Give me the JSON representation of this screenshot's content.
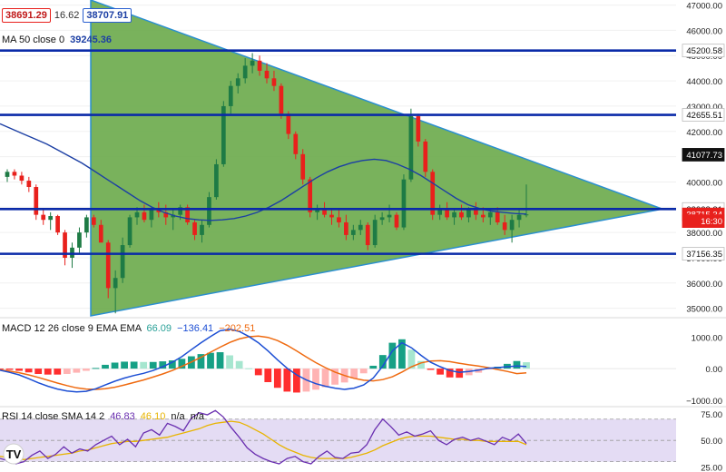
{
  "header": {
    "bid": "38691.29",
    "spread": "16.62",
    "ask": "38707.91",
    "ma_label": "MA 50 close 0",
    "ma_value": "39245.36"
  },
  "colors": {
    "up": "#1e7b45",
    "down": "#e8201c",
    "ma": "#1c3fa4",
    "line": "#0a2aa8",
    "triangle": "#6aaa4a",
    "triangle_edge": "#2a8fd0",
    "macd": "#1d4fd4",
    "signal": "#ef6a10",
    "rsi": "#6a2fb0",
    "rsi_sma": "#e8b400",
    "rsi_band": "#e4dcf4"
  },
  "chart_data": [
    {
      "type": "candlestick",
      "title": "",
      "y_ticks": [
        35000,
        36000,
        37000,
        38000,
        39000,
        40000,
        41000,
        42000,
        43000,
        44000,
        45000,
        46000,
        47000
      ],
      "ylim": [
        34700,
        47200
      ],
      "candles": [
        [
          40200,
          40500,
          40000,
          40400
        ],
        [
          40400,
          40500,
          40100,
          40250
        ],
        [
          40250,
          40400,
          39900,
          40050
        ],
        [
          40050,
          40200,
          39600,
          39800
        ],
        [
          39800,
          39900,
          38500,
          38700
        ],
        [
          38700,
          38900,
          38300,
          38500
        ],
        [
          38500,
          38800,
          38100,
          38650
        ],
        [
          38650,
          38700,
          37900,
          38000
        ],
        [
          38000,
          38100,
          36700,
          37000
        ],
        [
          37000,
          37600,
          36600,
          37400
        ],
        [
          37400,
          38200,
          37200,
          38000
        ],
        [
          38000,
          38700,
          37800,
          38600
        ],
        [
          38600,
          38700,
          38200,
          38300
        ],
        [
          38300,
          38500,
          37700,
          37600
        ],
        [
          37600,
          37700,
          35400,
          35800
        ],
        [
          35800,
          36500,
          34800,
          36200
        ],
        [
          36200,
          37800,
          36000,
          37500
        ],
        [
          37500,
          38700,
          37400,
          38600
        ],
        [
          38600,
          39000,
          38300,
          38800
        ],
        [
          38800,
          39100,
          38400,
          38500
        ],
        [
          38500,
          39000,
          38200,
          38900
        ],
        [
          38900,
          39200,
          38600,
          38800
        ],
        [
          38800,
          39100,
          38300,
          38600
        ],
        [
          38600,
          38900,
          38100,
          38700
        ],
        [
          38700,
          39100,
          38500,
          39000
        ],
        [
          39000,
          39100,
          38300,
          38400
        ],
        [
          38400,
          38500,
          37700,
          37900
        ],
        [
          37900,
          38500,
          37600,
          38300
        ],
        [
          38300,
          39600,
          38200,
          39400
        ],
        [
          39400,
          40900,
          39300,
          40700
        ],
        [
          40700,
          43200,
          40600,
          43000
        ],
        [
          43000,
          44000,
          42700,
          43800
        ],
        [
          43800,
          44300,
          43500,
          44100
        ],
        [
          44100,
          44900,
          43900,
          44600
        ],
        [
          44600,
          45100,
          44300,
          44800
        ],
        [
          44800,
          45000,
          44200,
          44400
        ],
        [
          44400,
          44700,
          43900,
          44100
        ],
        [
          44100,
          44400,
          43600,
          43800
        ],
        [
          43800,
          43900,
          42500,
          42700
        ],
        [
          42700,
          42800,
          41700,
          41900
        ],
        [
          41900,
          42000,
          40900,
          41100
        ],
        [
          41100,
          41300,
          39900,
          40100
        ],
        [
          40100,
          40200,
          38600,
          38800
        ],
        [
          38800,
          39100,
          38500,
          38900
        ],
        [
          38900,
          39200,
          38600,
          38700
        ],
        [
          38700,
          38900,
          38300,
          38600
        ],
        [
          38600,
          38900,
          38200,
          38400
        ],
        [
          38400,
          38700,
          37700,
          37900
        ],
        [
          37900,
          38300,
          37700,
          38100
        ],
        [
          38100,
          38500,
          37900,
          38300
        ],
        [
          38300,
          38400,
          37300,
          37500
        ],
        [
          37500,
          38700,
          37400,
          38500
        ],
        [
          38500,
          38800,
          38300,
          38600
        ],
        [
          38600,
          39100,
          38400,
          38700
        ],
        [
          38700,
          38800,
          38100,
          38200
        ],
        [
          38200,
          40300,
          38100,
          40100
        ],
        [
          40100,
          42900,
          40000,
          42600
        ],
        [
          42600,
          42700,
          41400,
          41600
        ],
        [
          41600,
          41700,
          40200,
          40400
        ],
        [
          40400,
          40500,
          38500,
          38700
        ],
        [
          38700,
          39100,
          38500,
          38900
        ],
        [
          38900,
          39200,
          38500,
          38600
        ],
        [
          38600,
          38900,
          38300,
          38800
        ],
        [
          38800,
          39100,
          38500,
          38600
        ],
        [
          38600,
          39000,
          38400,
          38900
        ],
        [
          38900,
          39200,
          38500,
          38700
        ],
        [
          38700,
          39000,
          38400,
          38600
        ],
        [
          38600,
          38900,
          38300,
          38800
        ],
        [
          38800,
          39000,
          38300,
          38400
        ],
        [
          38400,
          38700,
          37900,
          38100
        ],
        [
          38100,
          38700,
          37600,
          38500
        ],
        [
          38500,
          38900,
          38200,
          38700
        ],
        [
          38700,
          39900,
          38600,
          38715
        ]
      ],
      "ma50": [
        42300,
        42100,
        41900,
        41700,
        41500,
        41250,
        41000,
        40750,
        40450,
        40150,
        39850,
        39550,
        39250,
        39000,
        38800,
        38650,
        38550,
        38500,
        38480,
        38500,
        38550,
        38650,
        38800,
        39000,
        39250,
        39550,
        39850,
        40150,
        40400,
        40600,
        40750,
        40850,
        40900,
        40850,
        40700,
        40500,
        40250,
        39950,
        39650,
        39350,
        39100,
        38950,
        38850,
        38800,
        38750,
        38730
      ],
      "h_lines": [
        45200.58,
        42655.51,
        38928.81,
        37156.35
      ],
      "price_labels": [
        {
          "text": "45200.58",
          "v": 45200.58
        },
        {
          "text": "42655.51",
          "v": 42655.51
        },
        {
          "text": "41077.73",
          "v": 41077.73
        },
        {
          "text": "38928.81",
          "v": 38928.81
        },
        {
          "text": "38715.34",
          "v": 38715.34
        },
        {
          "text": "16:30",
          "v": 38450
        },
        {
          "text": "37156.35",
          "v": 37156.35
        }
      ]
    },
    {
      "type": "line",
      "title": "MACD 12 26 close 9 EMA EMA",
      "values_text": [
        "66.09",
        "−136.41",
        "−202.51"
      ],
      "y_ticks": [
        "1000.00",
        "0.00",
        "−1000.00"
      ],
      "tick_values": [
        1000,
        0,
        -1000
      ],
      "ylim": [
        -1150,
        1500
      ],
      "macd": [
        -50,
        -120,
        -200,
        -320,
        -450,
        -560,
        -650,
        -710,
        -740,
        -720,
        -640,
        -520,
        -400,
        -300,
        -220,
        -150,
        -60,
        60,
        200,
        380,
        600,
        820,
        1020,
        1200,
        1250,
        1180,
        1020,
        820,
        560,
        280,
        10,
        -200,
        -360,
        -480,
        -560,
        -620,
        -660,
        -620,
        -520,
        -300,
        80,
        560,
        820,
        660,
        420,
        200,
        60,
        -60,
        -120,
        -90,
        -50,
        10,
        30,
        60,
        80,
        66
      ],
      "signal": [
        -40,
        -80,
        -130,
        -200,
        -280,
        -370,
        -460,
        -540,
        -610,
        -650,
        -660,
        -640,
        -590,
        -520,
        -440,
        -360,
        -270,
        -170,
        -60,
        70,
        210,
        360,
        520,
        680,
        830,
        940,
        1010,
        1030,
        990,
        890,
        740,
        560,
        370,
        190,
        30,
        -110,
        -220,
        -310,
        -370,
        -390,
        -350,
        -260,
        -110,
        60,
        180,
        240,
        250,
        220,
        170,
        120,
        80,
        30,
        -30,
        -90,
        -160,
        -136
      ],
      "histogram": [
        -10,
        -40,
        -70,
        -120,
        -170,
        -190,
        -190,
        -170,
        -130,
        -70,
        20,
        120,
        190,
        220,
        220,
        210,
        210,
        230,
        260,
        310,
        390,
        460,
        500,
        520,
        420,
        240,
        10,
        -210,
        -430,
        -610,
        -730,
        -760,
        -730,
        -670,
        -590,
        -510,
        -440,
        -310,
        -150,
        90,
        430,
        820,
        930,
        600,
        240,
        -40,
        -190,
        -280,
        -290,
        -210,
        -130,
        -20,
        60,
        150,
        240,
        202
      ]
    },
    {
      "type": "line",
      "title": "RSI 14 close SMA 14 2",
      "values_text": [
        "46.83",
        "46.10",
        "n/a",
        "n/a"
      ],
      "y_ticks": [
        "75.00",
        "50.00",
        "25.00"
      ],
      "tick_values": [
        75,
        50,
        25
      ],
      "ylim": [
        22,
        80
      ],
      "rsi": [
        33,
        31,
        28,
        30,
        36,
        40,
        33,
        37,
        44,
        38,
        42,
        40,
        46,
        50,
        54,
        46,
        51,
        44,
        57,
        60,
        55,
        66,
        63,
        59,
        71,
        76,
        74,
        78,
        72,
        62,
        53,
        43,
        37,
        33,
        30,
        28,
        33,
        35,
        30,
        28,
        35,
        40,
        34,
        33,
        38,
        39,
        46,
        60,
        70,
        63,
        55,
        58,
        54,
        56,
        59,
        50,
        46,
        51,
        53,
        50,
        52,
        49,
        46,
        53,
        50,
        56,
        47
      ],
      "rsi_sma": [
        35,
        34,
        33,
        32,
        33,
        34,
        35,
        36,
        37,
        38,
        40,
        41,
        43,
        45,
        47,
        48,
        49,
        49,
        50,
        51,
        52,
        53,
        55,
        57,
        59,
        61,
        64,
        66,
        67,
        68,
        67,
        64,
        60,
        56,
        51,
        46,
        42,
        39,
        36,
        34,
        33,
        33,
        33,
        33,
        34,
        36,
        38,
        41,
        45,
        48,
        51,
        53,
        54,
        54,
        54,
        53,
        52,
        51,
        51,
        50,
        50,
        49,
        49,
        49,
        49,
        49,
        46
      ]
    }
  ]
}
